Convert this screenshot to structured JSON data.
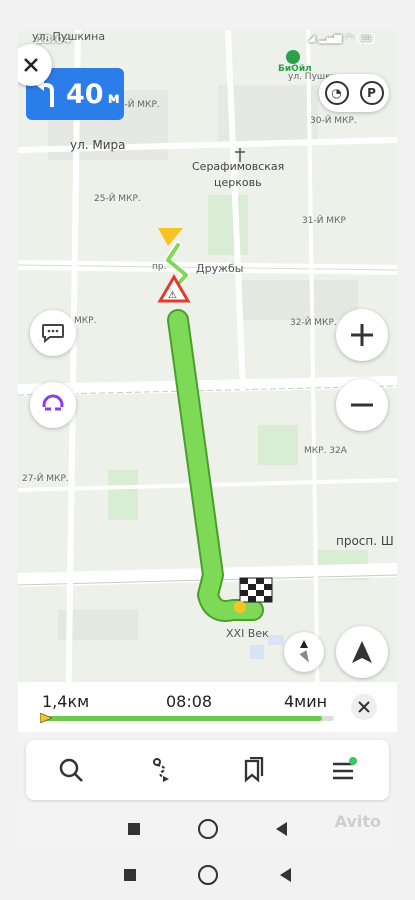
{
  "status_bar": {
    "time": "18:04",
    "battery": "29"
  },
  "map": {
    "street_labels": {
      "top_street": "ул. Пушкина",
      "mira": "ул. Мира",
      "top_right_street": "ул. Пушкина",
      "druzhby": "Дружбы",
      "druzhby_prefix": "пр.",
      "prospect": "просп. Ш"
    },
    "district_labels": {
      "mkr_41": "41-Й МКР.",
      "mkr_30": "30-Й МКР.",
      "mkr_25": "25-Й МКР.",
      "mkr_31": "31-Й МКР",
      "mkr_left": "МКР.",
      "mkr_32": "32-Й МКР.",
      "mkr_27": "27-Й МКР.",
      "mkr_32a": "МКР. 32А"
    },
    "poi": {
      "church": "Серафимовская\nцерковь",
      "church_line1": "Серафимовская",
      "church_line2": "церковь",
      "fuel": "БиОйл",
      "destination": "XXI Век"
    }
  },
  "maneuver": {
    "distance": "40",
    "unit": "м"
  },
  "trip": {
    "distance": "1,4км",
    "arrival_time": "08:08",
    "duration": "4мин",
    "progress_fraction": 0.96
  },
  "toolbar": {
    "items": [
      "search-icon",
      "route-icon",
      "bookmarks-icon",
      "menu-icon"
    ]
  },
  "watermark": "Avito",
  "colors": {
    "route": "#7ed957",
    "maneuver_card": "#2b7de9",
    "alice": "#8b3cf0",
    "menu_dot": "#3cc75a"
  }
}
